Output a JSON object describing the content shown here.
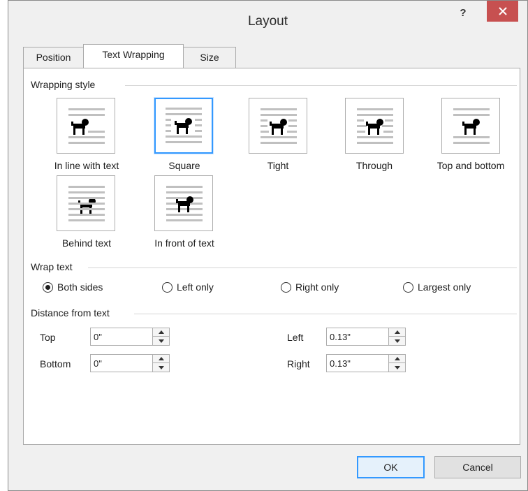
{
  "window": {
    "title": "Layout",
    "help_label": "?"
  },
  "tabs": [
    {
      "label": "Position"
    },
    {
      "label": "Text Wrapping",
      "active": true
    },
    {
      "label": "Size"
    }
  ],
  "wrapping_style": {
    "heading": "Wrapping style",
    "selected": "Square",
    "options": [
      {
        "label": "In line with text",
        "icon": "inline-wrap-icon"
      },
      {
        "label": "Square",
        "icon": "square-wrap-icon"
      },
      {
        "label": "Tight",
        "icon": "tight-wrap-icon"
      },
      {
        "label": "Through",
        "icon": "through-wrap-icon"
      },
      {
        "label": "Top and bottom",
        "icon": "top-bottom-wrap-icon"
      },
      {
        "label": "Behind text",
        "icon": "behind-text-icon"
      },
      {
        "label": "In front of text",
        "icon": "in-front-text-icon"
      }
    ]
  },
  "wrap_text": {
    "heading": "Wrap text",
    "options": [
      {
        "label": "Both sides",
        "checked": true
      },
      {
        "label": "Left only",
        "checked": false
      },
      {
        "label": "Right only",
        "checked": false
      },
      {
        "label": "Largest only",
        "checked": false
      }
    ]
  },
  "distance": {
    "heading": "Distance from text",
    "top": {
      "label": "Top",
      "value": "0\""
    },
    "bottom": {
      "label": "Bottom",
      "value": "0\""
    },
    "left": {
      "label": "Left",
      "value": "0.13\""
    },
    "right": {
      "label": "Right",
      "value": "0.13\""
    }
  },
  "buttons": {
    "ok": "OK",
    "cancel": "Cancel"
  },
  "colors": {
    "accent": "#3399ff",
    "close": "#c75050"
  }
}
